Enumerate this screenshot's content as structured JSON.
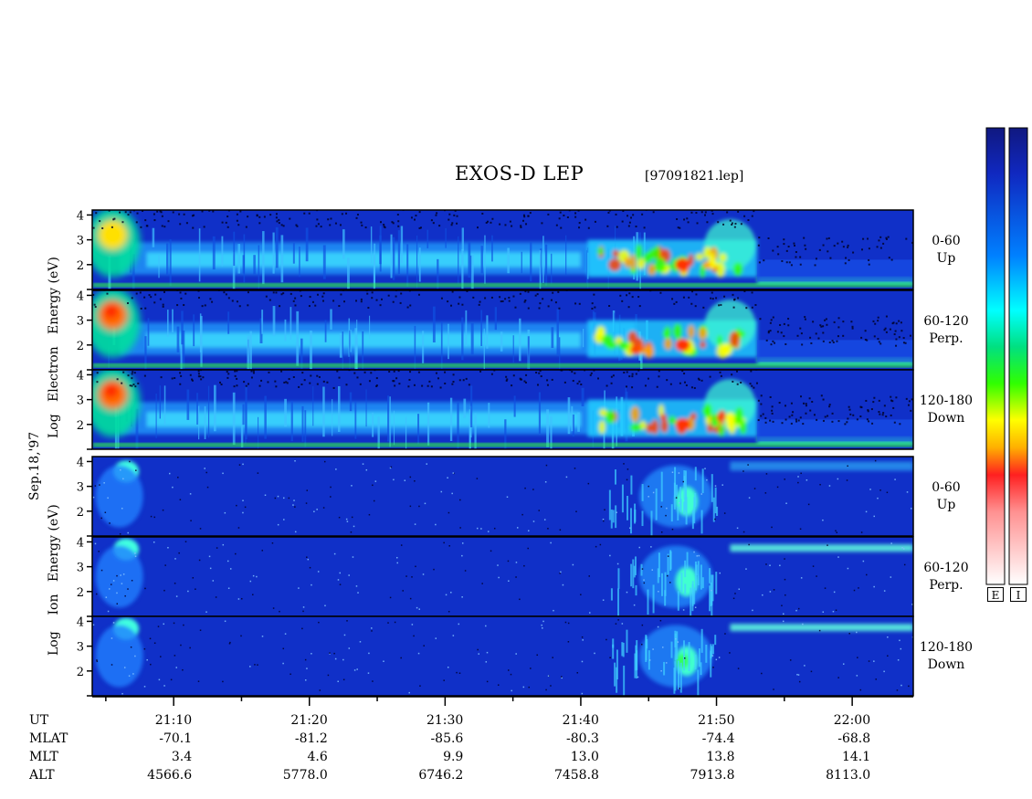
{
  "title": "EXOS-D LEP",
  "filename": "[97091821.lep]",
  "date_label": "Sep.18,'97",
  "electron_axis_label": [
    "Log",
    "Electron",
    "Energy",
    "(eV)"
  ],
  "ion_axis_label": [
    "Log",
    "Ion",
    "Energy",
    "(eV)"
  ],
  "colorbar_labels": {
    "electron": "E",
    "ion": "I"
  },
  "colors": {
    "background": "#1030c8",
    "colormap": [
      "#ffffff",
      "#ffc0c0",
      "#ff2020",
      "#ffa000",
      "#ffff00",
      "#40ff00",
      "#00e060",
      "#00ffff",
      "#0080ff",
      "#1030d0",
      "#101880"
    ]
  },
  "chart_data": {
    "type": "heatmap",
    "x_axis": {
      "label": "UT",
      "ticks": [
        "21:10",
        "21:20",
        "21:30",
        "21:40",
        "21:50",
        "22:00"
      ],
      "range_minutes": [
        1264,
        1324.5
      ]
    },
    "ephemeris": [
      {
        "name": "UT",
        "values": [
          "21:10",
          "21:20",
          "21:30",
          "21:40",
          "21:50",
          "22:00"
        ]
      },
      {
        "name": "MLAT",
        "values": [
          "-70.1",
          "-81.2",
          "-85.6",
          "-80.3",
          "-74.4",
          "-68.8"
        ]
      },
      {
        "name": "MLT",
        "values": [
          "3.4",
          "4.6",
          "9.9",
          "13.0",
          "13.8",
          "14.1"
        ]
      },
      {
        "name": "ALT",
        "values": [
          "4566.6",
          "5778.0",
          "6746.2",
          "7458.8",
          "7913.8",
          "8113.0"
        ]
      }
    ],
    "y_axis": {
      "label": "Log Energy (eV)",
      "range": [
        1,
        4.2
      ],
      "ticks": [
        "4",
        "3",
        "2"
      ]
    },
    "panels": [
      {
        "species": "Electron",
        "pitch_angle": "0-60",
        "direction": "Up"
      },
      {
        "species": "Electron",
        "pitch_angle": "60-120",
        "direction": "Perp."
      },
      {
        "species": "Electron",
        "pitch_angle": "120-180",
        "direction": "Down"
      },
      {
        "species": "Ion",
        "pitch_angle": "0-60",
        "direction": "Up"
      },
      {
        "species": "Ion",
        "pitch_angle": "60-120",
        "direction": "Perp."
      },
      {
        "species": "Ion",
        "pitch_angle": "120-180",
        "direction": "Down"
      }
    ]
  }
}
